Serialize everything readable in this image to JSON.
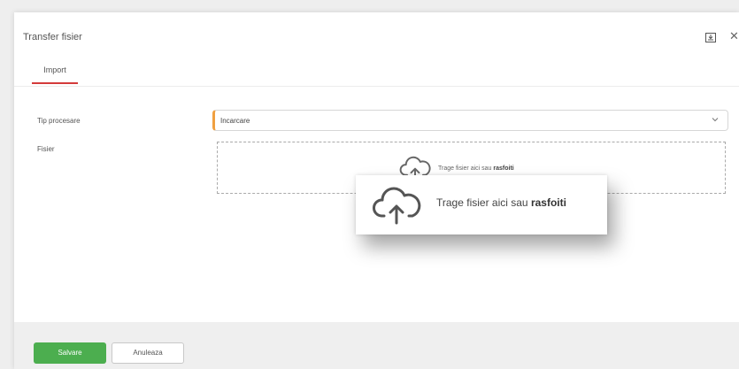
{
  "dialog": {
    "title": "Transfer fisier",
    "tabs": [
      {
        "label": "Import",
        "active": true
      }
    ]
  },
  "form": {
    "tip_procesare": {
      "label": "Tip procesare",
      "value": "Incarcare"
    },
    "fisier": {
      "label": "Fisier"
    }
  },
  "dropzone": {
    "text": "Trage fisier aici sau",
    "link": "rasfoiti"
  },
  "tooltip": {
    "text": "Trage fisier aici sau",
    "link": "rasfoiti"
  },
  "footer": {
    "save_label": "Salvare",
    "cancel_label": "Anuleaza"
  },
  "colors": {
    "accent_tab": "#d43b3b",
    "select_accent": "#f0a040",
    "save_button": "#4cae4f"
  },
  "icons": {
    "header_export": "export-icon",
    "header_close": "close-icon",
    "upload": "cloud-upload-icon",
    "select": "chevron-down-icon"
  }
}
